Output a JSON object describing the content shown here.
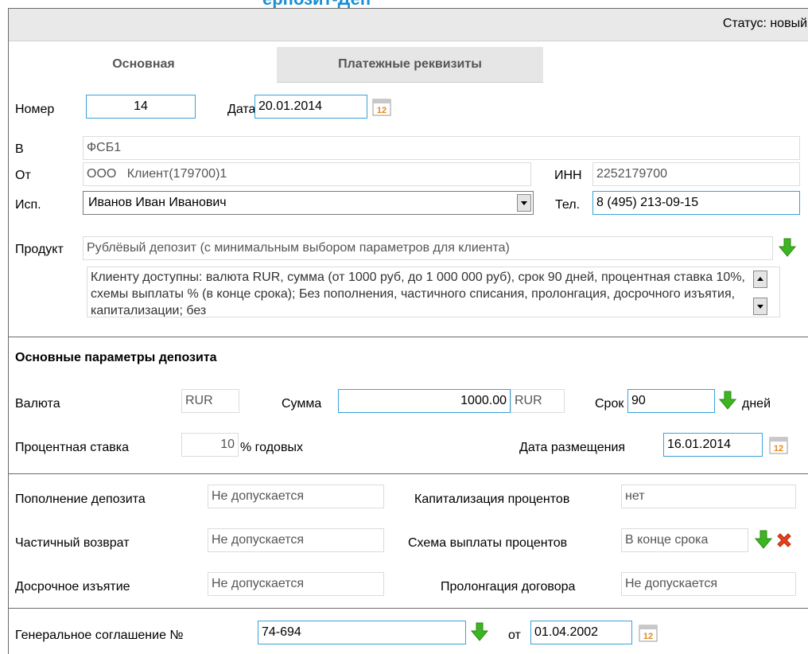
{
  "page": {
    "title_fragment": "ерпозит-Деп"
  },
  "status": {
    "text": "Статус: новый"
  },
  "tabs": [
    {
      "label": "Основная"
    },
    {
      "label": "Платежные реквизиты"
    }
  ],
  "header": {
    "number_label": "Номер",
    "number_value": "14",
    "date_label": "Дата",
    "date_value": "20.01.2014",
    "to_label": "В",
    "to_value": "ФСБ1",
    "from_label": "От",
    "from_prefix": "ООО",
    "from_value": "Клиент(179700)1",
    "inn_label": "ИНН",
    "inn_value": "2252179700",
    "exec_label": "Исп.",
    "exec_value": "Иванов Иван Иванович",
    "phone_label": "Тел.",
    "phone_value": "8 (495) 213-09-15"
  },
  "product": {
    "label": "Продукт",
    "value": "Рублёвый депозит (с минимальным выбором параметров для клиента)",
    "description": "Клиенту доступны: валюта RUR, сумма (от 1000 руб, до 1 000 000 руб), срок 90 дней, процентная ставка 10%, схемы выплаты % (в конце срока); Без пополнения, частичного списания, пролонгация, досрочного изъятия, капитализации; без"
  },
  "params": {
    "section_title": "Основные параметры депозита",
    "currency_label": "Валюта",
    "currency_value": "RUR",
    "amount_label": "Сумма",
    "amount_value": "1000.00",
    "amount_currency": "RUR",
    "term_label": "Срок",
    "term_value": "90",
    "term_unit": "дней",
    "rate_label": "Процентная ставка",
    "rate_value": "10",
    "rate_unit": "% годовых",
    "placement_label": "Дата размещения",
    "placement_value": "16.01.2014"
  },
  "conditions": {
    "topup_label": "Пополнение депозита",
    "topup_value": "Не допускается",
    "cap_label": "Капитализация процентов",
    "cap_value": "нет",
    "partial_label": "Частичный возврат",
    "partial_value": "Не допускается",
    "scheme_label": "Схема выплаты процентов",
    "scheme_value": "В конце срока",
    "early_label": "Досрочное изъятие",
    "early_value": "Не допускается",
    "prolong_label": "Пролонгация договора",
    "prolong_value": "Не допускается"
  },
  "agreement": {
    "label": "Генеральное соглашение №",
    "value": "74-694",
    "from_label": "от",
    "date_value": "01.04.2002"
  },
  "icons": {
    "calendar_day": "12"
  },
  "colors": {
    "accent": "#3aa3d8",
    "title": "#1a8fd6",
    "arrow": "#3cb521",
    "delete": "#e8401c"
  }
}
